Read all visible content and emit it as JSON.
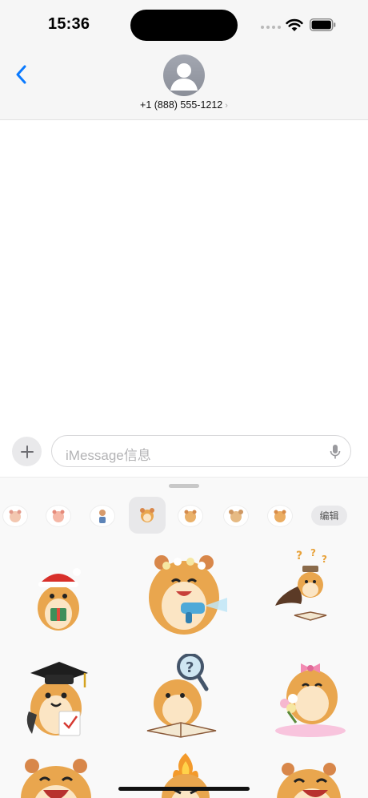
{
  "status_bar": {
    "time": "15:36"
  },
  "nav": {
    "contact": "+1 (888) 555-1212",
    "chevron": "›"
  },
  "compose": {
    "placeholder": "iMessage信息"
  },
  "drawer": {
    "edit_label": "编辑"
  },
  "icons": {
    "back": "chevron-left-icon",
    "plus": "plus-icon",
    "mic": "microphone-icon",
    "wifi": "wifi-icon",
    "battery": "battery-icon",
    "avatar": "person-icon"
  },
  "colors": {
    "accent": "#0a7aff",
    "hamster": "#e9a64e"
  },
  "sticker_packs": [
    "pack-1",
    "pack-2",
    "pack-3",
    "pack-4",
    "pack-5",
    "pack-6",
    "pack-7"
  ],
  "stickers": [
    "hamster-santa-hat-gift",
    "hamster-flower-crown-water-gun",
    "hamster-cape-book-question",
    "hamster-graduation-cap",
    "hamster-magnifier-book",
    "hamster-pink-bow-bouquet",
    "hamster-laughing",
    "hamster-flame",
    "hamster-laughing-2"
  ]
}
